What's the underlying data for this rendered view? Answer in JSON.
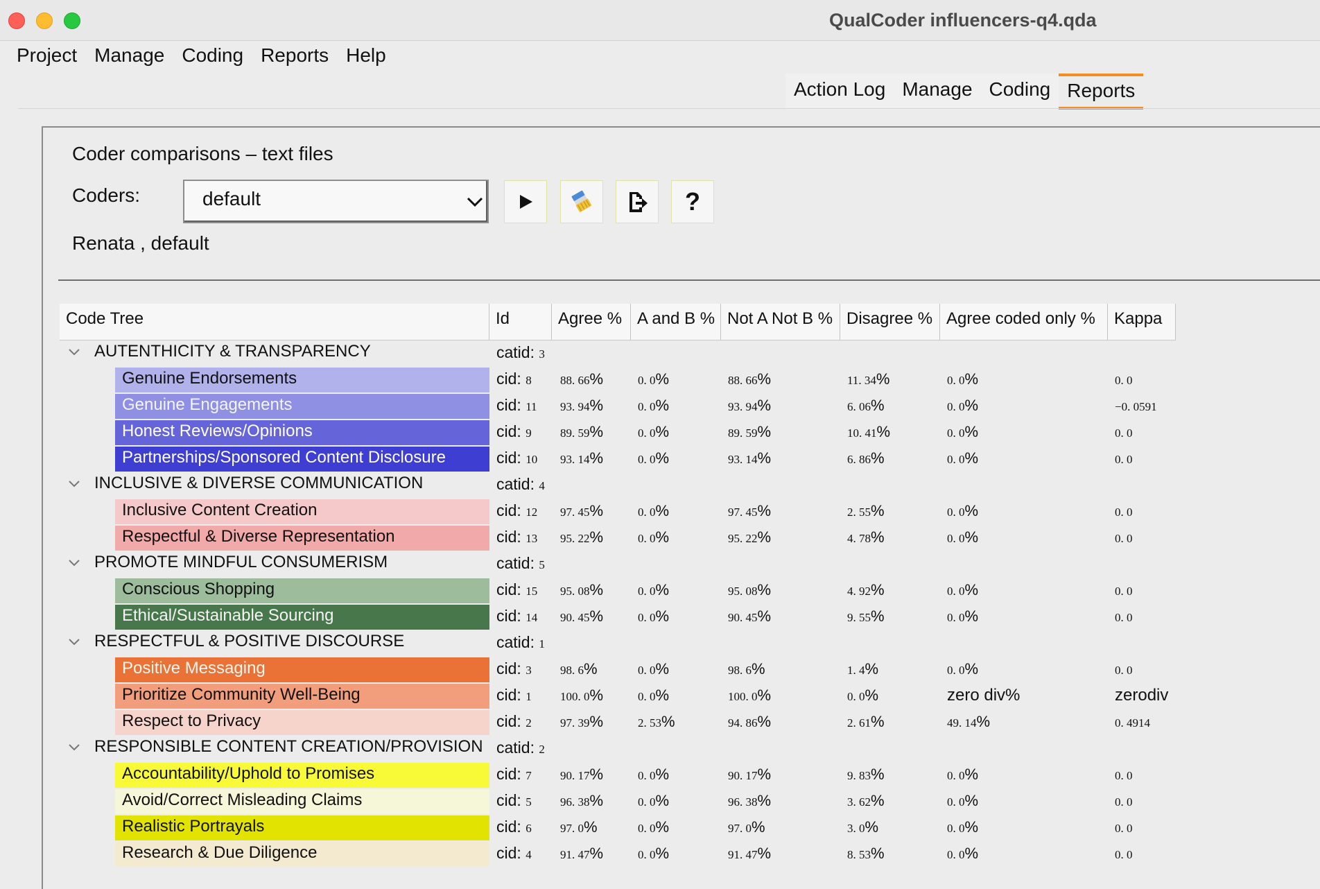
{
  "window": {
    "title": "QualCoder influencers-q4.qda"
  },
  "menubar": [
    "Project",
    "Manage",
    "Coding",
    "Reports",
    "Help"
  ],
  "tabs": [
    {
      "label": "Action Log",
      "active": false
    },
    {
      "label": "Manage",
      "active": false
    },
    {
      "label": "Coding",
      "active": false
    },
    {
      "label": "Reports",
      "active": true
    }
  ],
  "report": {
    "heading": "Coder comparisons – text files",
    "coders_label": "Coders:",
    "coders_selected_value": "default",
    "selected_coders_text": "Renata , default",
    "toolbar_icons": [
      "run-icon",
      "clear-icon",
      "export-icon",
      "help-icon"
    ]
  },
  "table": {
    "columns": [
      "Code Tree",
      "Id",
      "Agree %",
      "A and B %",
      "Not A Not B %",
      "Disagree %",
      "Agree coded only %",
      "Kappa"
    ],
    "rows": [
      {
        "type": "category",
        "name": "AUTENTHICITY & TRANSPARENCY",
        "id_prefix": "catid:",
        "id_num": "3"
      },
      {
        "type": "code",
        "name": "Genuine Endorsements",
        "color": "#b1b1ec",
        "text_color": "#111111",
        "id_prefix": "cid:",
        "id_num": "8",
        "agree": "88. 66",
        "ab": "0. 0",
        "notab": "88. 66",
        "disagree": "11. 34",
        "agree_coded": "0. 0",
        "kappa": "0. 0"
      },
      {
        "type": "code",
        "name": "Genuine Engagements",
        "color": "#8f8fe4",
        "text_color": "#f4f4ff",
        "id_prefix": "cid:",
        "id_num": "11",
        "agree": "93. 94",
        "ab": "0. 0",
        "notab": "93. 94",
        "disagree": "6. 06",
        "agree_coded": "0. 0",
        "kappa": "−0. 0591"
      },
      {
        "type": "code",
        "name": "Honest Reviews/Opinions",
        "color": "#6565d9",
        "text_color": "#ffffff",
        "id_prefix": "cid:",
        "id_num": "9",
        "agree": "89. 59",
        "ab": "0. 0",
        "notab": "89. 59",
        "disagree": "10. 41",
        "agree_coded": "0. 0",
        "kappa": "0. 0"
      },
      {
        "type": "code",
        "name": "Partnerships/Sponsored Content Disclosure",
        "color": "#3e3ed2",
        "text_color": "#ffffff",
        "id_prefix": "cid:",
        "id_num": "10",
        "agree": "93. 14",
        "ab": "0. 0",
        "notab": "93. 14",
        "disagree": "6. 86",
        "agree_coded": "0. 0",
        "kappa": "0. 0"
      },
      {
        "type": "category",
        "name": "INCLUSIVE & DIVERSE COMMUNICATION",
        "id_prefix": "catid:",
        "id_num": "4"
      },
      {
        "type": "code",
        "name": "Inclusive Content Creation",
        "color": "#f5c9c9",
        "text_color": "#111111",
        "id_prefix": "cid:",
        "id_num": "12",
        "agree": "97. 45",
        "ab": "0. 0",
        "notab": "97. 45",
        "disagree": "2. 55",
        "agree_coded": "0. 0",
        "kappa": "0. 0"
      },
      {
        "type": "code",
        "name": "Respectful & Diverse Representation",
        "color": "#f2a9a9",
        "text_color": "#111111",
        "id_prefix": "cid:",
        "id_num": "13",
        "agree": "95. 22",
        "ab": "0. 0",
        "notab": "95. 22",
        "disagree": "4. 78",
        "agree_coded": "0. 0",
        "kappa": "0. 0"
      },
      {
        "type": "category",
        "name": "PROMOTE MINDFUL CONSUMERISM",
        "id_prefix": "catid:",
        "id_num": "5"
      },
      {
        "type": "code",
        "name": "Conscious Shopping",
        "color": "#9cbc9c",
        "text_color": "#111111",
        "id_prefix": "cid:",
        "id_num": "15",
        "agree": "95. 08",
        "ab": "0. 0",
        "notab": "95. 08",
        "disagree": "4. 92",
        "agree_coded": "0. 0",
        "kappa": "0. 0"
      },
      {
        "type": "code",
        "name": "Ethical/Sustainable Sourcing",
        "color": "#48774c",
        "text_color": "#f4f4f4",
        "id_prefix": "cid:",
        "id_num": "14",
        "agree": "90. 45",
        "ab": "0. 0",
        "notab": "90. 45",
        "disagree": "9. 55",
        "agree_coded": "0. 0",
        "kappa": "0. 0"
      },
      {
        "type": "category",
        "name": "RESPECTFUL & POSITIVE DISCOURSE",
        "id_prefix": "catid:",
        "id_num": "1"
      },
      {
        "type": "code",
        "name": "Positive Messaging",
        "color": "#ea7236",
        "text_color": "#fff6ee",
        "id_prefix": "cid:",
        "id_num": "3",
        "agree": "98. 6",
        "ab": "0. 0",
        "notab": "98. 6",
        "disagree": "1. 4",
        "agree_coded": "0. 0",
        "kappa": "0. 0"
      },
      {
        "type": "code",
        "name": "Prioritize Community Well-Being",
        "color": "#f29d7b",
        "text_color": "#111111",
        "id_prefix": "cid:",
        "id_num": "1",
        "agree": "100. 0",
        "ab": "0. 0",
        "notab": "100. 0",
        "disagree": "0. 0",
        "agree_coded": "zero div",
        "kappa": "zerodiv"
      },
      {
        "type": "code",
        "name": "Respect to Privacy",
        "color": "#f6d3cb",
        "text_color": "#111111",
        "id_prefix": "cid:",
        "id_num": "2",
        "agree": "97. 39",
        "ab": "2. 53",
        "notab": "94. 86",
        "disagree": "2. 61",
        "agree_coded": "49. 14",
        "kappa": "0. 4914"
      },
      {
        "type": "category",
        "name": "RESPONSIBLE CONTENT CREATION/PROVISION",
        "id_prefix": "catid:",
        "id_num": "2"
      },
      {
        "type": "code",
        "name": "Accountability/Uphold to Promises",
        "color": "#f8fa37",
        "text_color": "#111111",
        "id_prefix": "cid:",
        "id_num": "7",
        "agree": "90. 17",
        "ab": "0. 0",
        "notab": "90. 17",
        "disagree": "9. 83",
        "agree_coded": "0. 0",
        "kappa": "0. 0"
      },
      {
        "type": "code",
        "name": "Avoid/Correct Misleading Claims",
        "color": "#f6f7d8",
        "text_color": "#111111",
        "id_prefix": "cid:",
        "id_num": "5",
        "agree": "96. 38",
        "ab": "0. 0",
        "notab": "96. 38",
        "disagree": "3. 62",
        "agree_coded": "0. 0",
        "kappa": "0. 0"
      },
      {
        "type": "code",
        "name": "Realistic Portrayals",
        "color": "#e2e400",
        "text_color": "#111111",
        "id_prefix": "cid:",
        "id_num": "6",
        "agree": "97. 0",
        "ab": "0. 0",
        "notab": "97. 0",
        "disagree": "3. 0",
        "agree_coded": "0. 0",
        "kappa": "0. 0"
      },
      {
        "type": "code",
        "name": "Research & Due Diligence",
        "color": "#f4ead0",
        "text_color": "#111111",
        "id_prefix": "cid:",
        "id_num": "4",
        "agree": "91. 47",
        "ab": "0. 0",
        "notab": "91. 47",
        "disagree": "8. 53",
        "agree_coded": "0. 0",
        "kappa": "0. 0"
      }
    ]
  }
}
